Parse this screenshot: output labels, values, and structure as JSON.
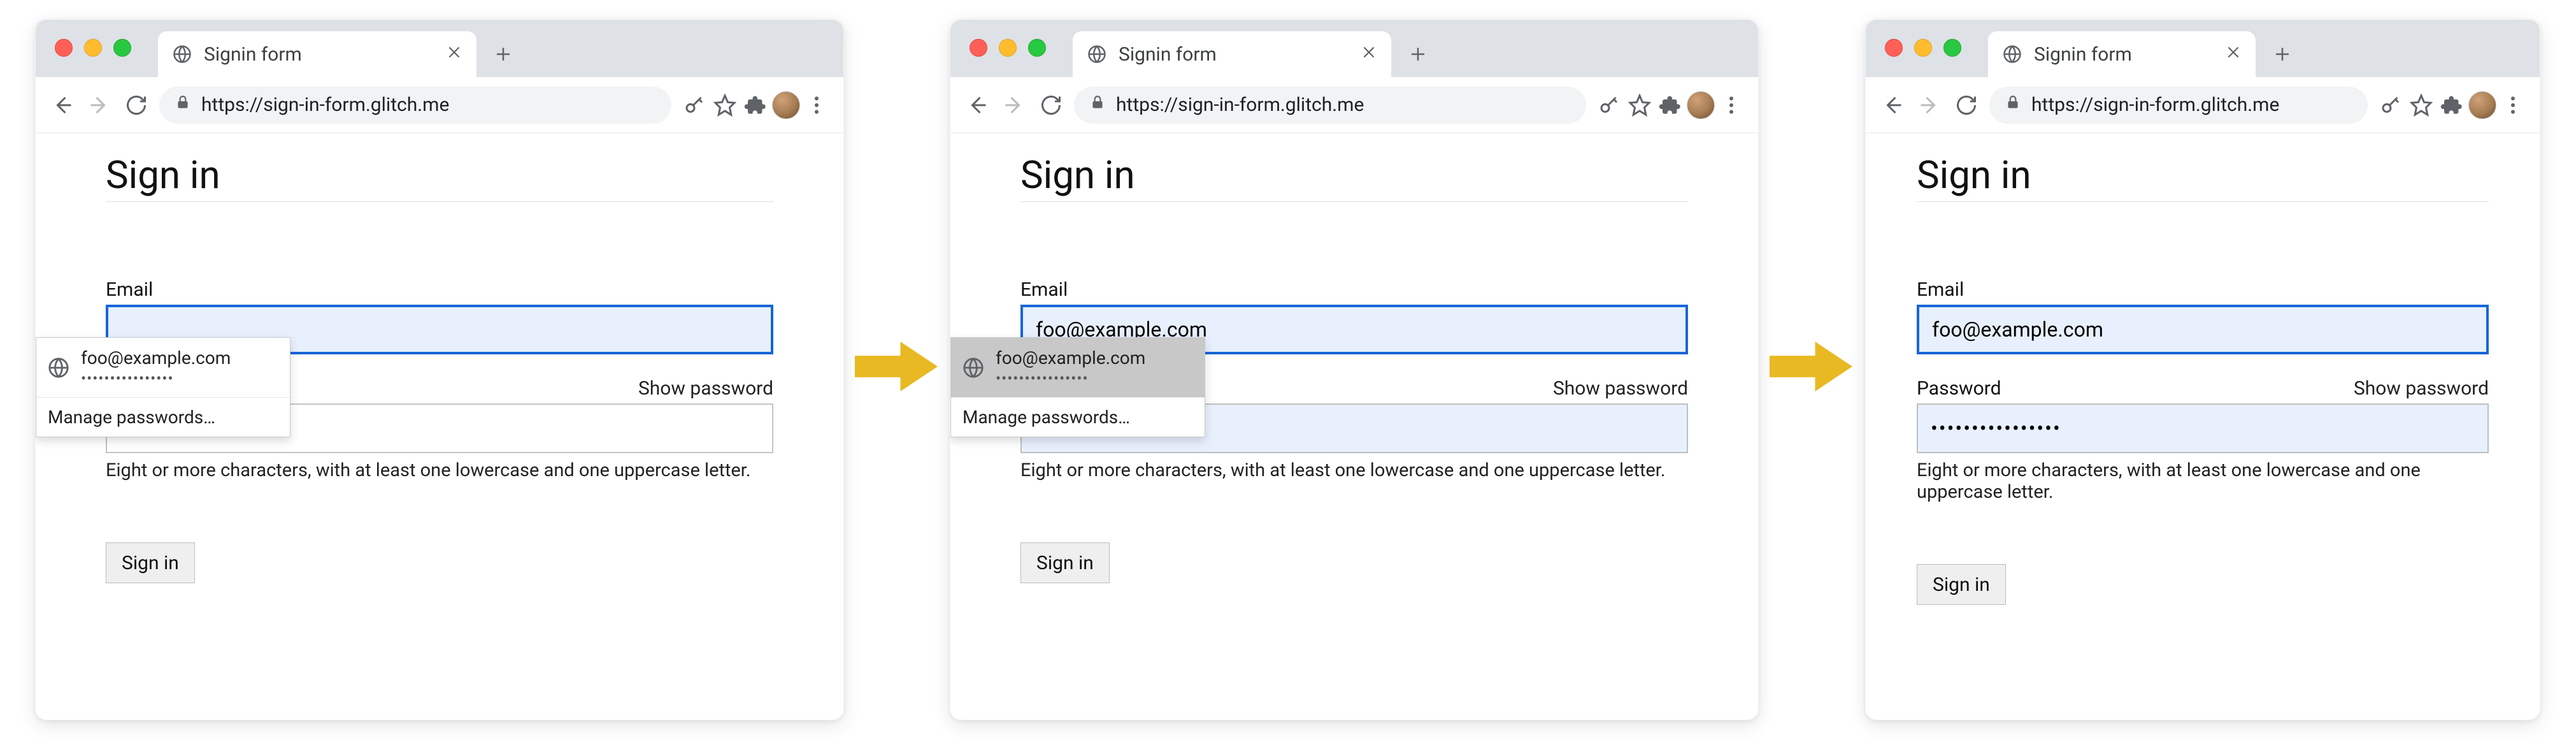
{
  "browser": {
    "tab_title": "Signin form",
    "url": "https://sign-in-form.glitch.me",
    "new_tab_label": "+"
  },
  "page": {
    "heading": "Sign in",
    "email_label": "Email",
    "password_label": "Password",
    "show_password_label": "Show password",
    "helper_text": "Eight or more characters, with at least one lowercase and one uppercase letter.",
    "signin_button": "Sign in"
  },
  "autofill": {
    "suggestion_email": "foo@example.com",
    "suggestion_mask": "••••••••••••••••",
    "manage_label": "Manage passwords…"
  },
  "states": {
    "s1": {
      "email_value": "",
      "password_value": ""
    },
    "s2": {
      "email_value": "foo@example.com",
      "password_value": ""
    },
    "s3": {
      "email_value": "foo@example.com",
      "password_value": "••••••••••••••••"
    }
  }
}
